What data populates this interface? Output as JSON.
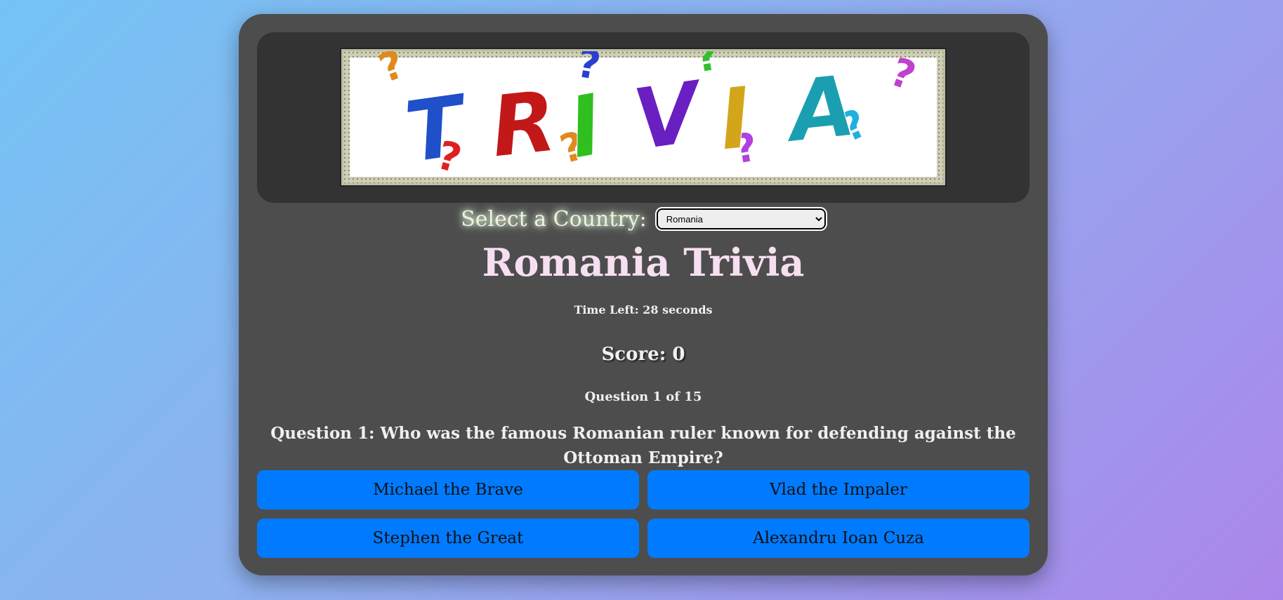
{
  "banner": {
    "word": "TRIVIA",
    "letter_colors": [
      "#1f4fc9",
      "#c21818",
      "#2fbf1f",
      "#6a1fc2",
      "#d3a51a",
      "#1a9fb0"
    ],
    "question_mark_colors": [
      "#e08a1e",
      "#2c3ed0",
      "#30c030",
      "#c040d0",
      "#e02020",
      "#e08a1e",
      "#b040e0",
      "#20b0e0"
    ]
  },
  "country": {
    "label": "Select a Country:",
    "selected": "Romania"
  },
  "game": {
    "title": "Romania Trivia",
    "timer": "Time Left: 28 seconds",
    "score": "Score: 0",
    "question_counter": "Question 1 of 15",
    "question": "Question 1: Who was the famous Romanian ruler known for defending against the Ottoman Empire?"
  },
  "answers": [
    "Michael the Brave",
    "Vlad the Impaler",
    "Stephen the Great",
    "Alexandru Ioan Cuza"
  ],
  "colors": {
    "background_start": "#74c3f4",
    "background_end": "#ab86ea",
    "card": "#4d4d4d",
    "answer_button": "#007bff",
    "title": "#f6dff0"
  }
}
